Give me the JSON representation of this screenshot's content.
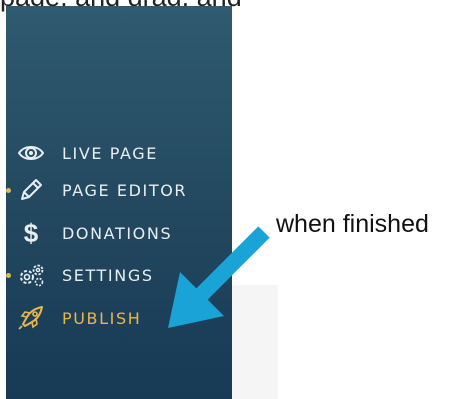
{
  "top_text": "page, and drag, and",
  "sidebar": {
    "items": [
      {
        "label": "LIVE PAGE",
        "icon": "eye-icon",
        "active": false
      },
      {
        "label": "PAGE EDITOR",
        "icon": "pencil-icon",
        "active": false
      },
      {
        "label": "DONATIONS",
        "icon": "dollar-icon",
        "active": false
      },
      {
        "label": "SETTINGS",
        "icon": "gears-icon",
        "active": false
      },
      {
        "label": "PUBLISH",
        "icon": "rocket-icon",
        "active": true
      }
    ]
  },
  "annotation": {
    "text": "when finished",
    "arrow_color": "#1aa3d6"
  },
  "colors": {
    "accent": "#e6b84d",
    "sidebar_top": "#2f5a70",
    "sidebar_bottom": "#173a55"
  }
}
